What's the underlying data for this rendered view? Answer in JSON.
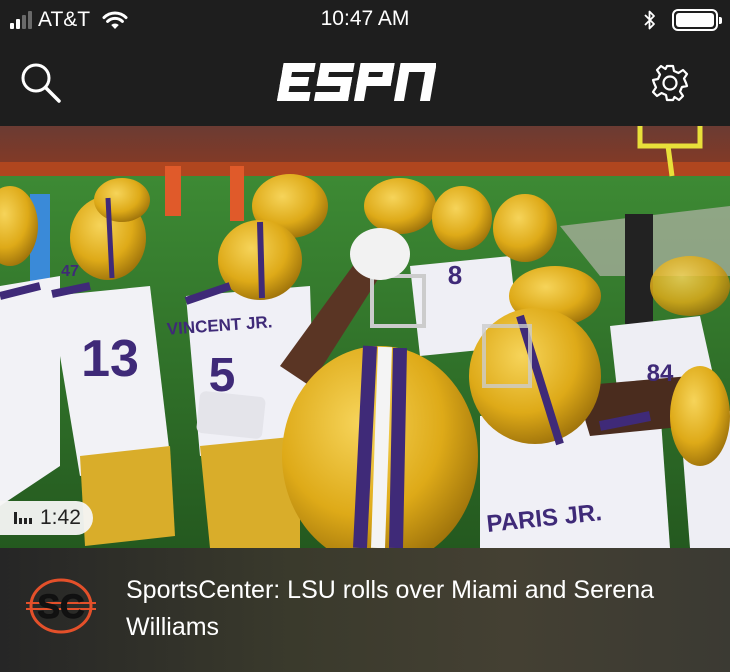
{
  "status_bar": {
    "carrier": "AT&T",
    "time": "10:47 AM",
    "signal_bars": 4,
    "signal_bars_active": 2,
    "wifi_icon": "wifi-icon",
    "bluetooth_icon": "bluetooth-icon",
    "battery_level": 1.0
  },
  "header": {
    "logo_text": "ESPN",
    "search_icon": "search-icon",
    "settings_icon": "gear-icon"
  },
  "hero": {
    "duration": "1:42",
    "duration_icon": "signal-bars-icon",
    "jersey_numbers": [
      "13",
      "5",
      "8",
      "84",
      "47"
    ],
    "jersey_names": [
      "VINCENT JR.",
      "PARIS JR."
    ]
  },
  "story": {
    "logo_text": "SC",
    "title": "SportsCenter: LSU rolls over Miami and Serena Williams"
  },
  "colors": {
    "background": "#1e1e1e",
    "lsu_gold": "#e8b61c",
    "lsu_purple": "#3f2a78",
    "field_green": "#2e6b2a",
    "sc_orange": "#e4502a"
  }
}
